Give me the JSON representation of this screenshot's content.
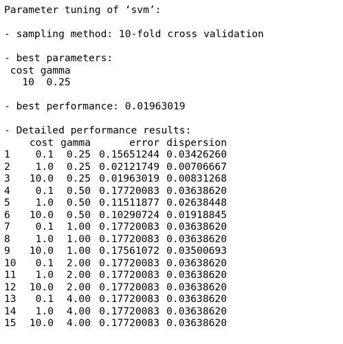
{
  "heading": "Parameter tuning of ‘svm’:",
  "sampling": "- sampling method: 10-fold cross validation",
  "best_params": {
    "label": "- best parameters:",
    "header": " cost gamma",
    "values": "   10  0.25"
  },
  "best_performance": "- best performance: 0.01963019",
  "detailed": {
    "label": "- Detailed performance results:",
    "columns": [
      "",
      "cost",
      "gamma",
      "error",
      "dispersion"
    ],
    "rows": [
      [
        "1",
        "0.1",
        "0.25",
        "0.15651244",
        "0.03426260"
      ],
      [
        "2",
        "1.0",
        "0.25",
        "0.02121749",
        "0.00706667"
      ],
      [
        "3",
        "10.0",
        "0.25",
        "0.01963019",
        "0.00831268"
      ],
      [
        "4",
        "0.1",
        "0.50",
        "0.17720083",
        "0.03638620"
      ],
      [
        "5",
        "1.0",
        "0.50",
        "0.11511877",
        "0.02638448"
      ],
      [
        "6",
        "10.0",
        "0.50",
        "0.10290724",
        "0.01918845"
      ],
      [
        "7",
        "0.1",
        "1.00",
        "0.17720083",
        "0.03638620"
      ],
      [
        "8",
        "1.0",
        "1.00",
        "0.17720083",
        "0.03638620"
      ],
      [
        "9",
        "10.0",
        "1.00",
        "0.17561072",
        "0.03500693"
      ],
      [
        "10",
        "0.1",
        "2.00",
        "0.17720083",
        "0.03638620"
      ],
      [
        "11",
        "1.0",
        "2.00",
        "0.17720083",
        "0.03638620"
      ],
      [
        "12",
        "10.0",
        "2.00",
        "0.17720083",
        "0.03638620"
      ],
      [
        "13",
        "0.1",
        "4.00",
        "0.17720083",
        "0.03638620"
      ],
      [
        "14",
        "1.0",
        "4.00",
        "0.17720083",
        "0.03638620"
      ],
      [
        "15",
        "10.0",
        "4.00",
        "0.17720083",
        "0.03638620"
      ]
    ]
  }
}
